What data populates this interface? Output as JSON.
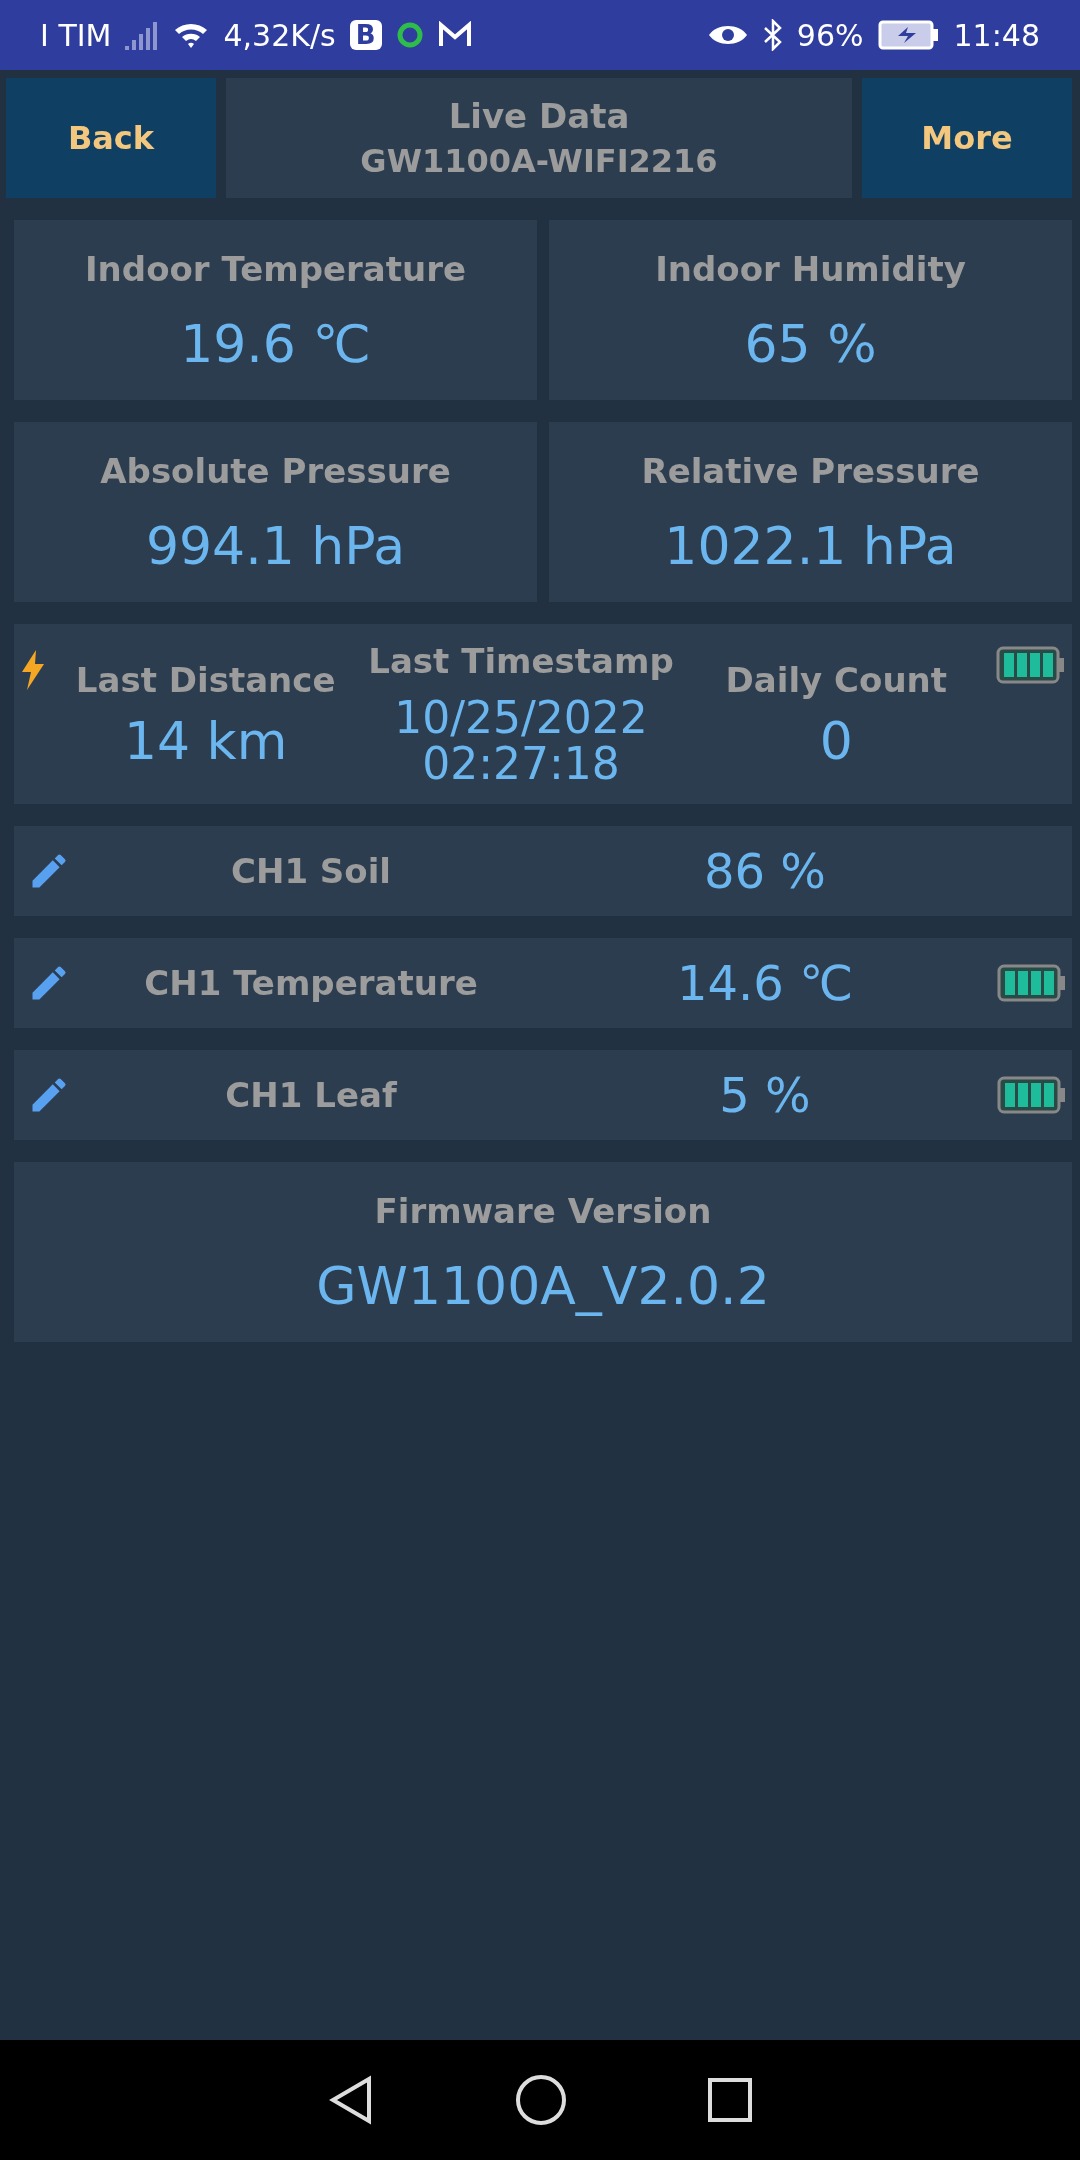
{
  "status_bar": {
    "carrier": "I TIM",
    "speed": "4,32K/s",
    "app_badge": "B",
    "battery_percent": "96%",
    "time": "11:48"
  },
  "header": {
    "back": "Back",
    "title": "Live Data",
    "subtitle": "GW1100A-WIFI2216",
    "more": "More"
  },
  "tiles": [
    {
      "label": "Indoor Temperature",
      "value": "19.6 ℃"
    },
    {
      "label": "Indoor Humidity",
      "value": "65 %"
    },
    {
      "label": "Absolute Pressure",
      "value": "994.1 hPa"
    },
    {
      "label": "Relative Pressure",
      "value": "1022.1 hPa"
    }
  ],
  "lightning": {
    "columns": [
      {
        "label": "Last Distance",
        "value": "14 km"
      },
      {
        "label": "Last Timestamp",
        "value": "10/25/2022\n02:27:18"
      },
      {
        "label": "Daily Count",
        "value": "0"
      }
    ],
    "battery": true
  },
  "channels": [
    {
      "name": "CH1 Soil",
      "value": "86 %"
    },
    {
      "name": "CH1 Temperature",
      "value": "14.6 ℃",
      "battery": true
    },
    {
      "name": "CH1 Leaf",
      "value": "5 %",
      "battery": true
    }
  ],
  "firmware": {
    "label": "Firmware Version",
    "value": "GW1100A_V2.0.2"
  }
}
